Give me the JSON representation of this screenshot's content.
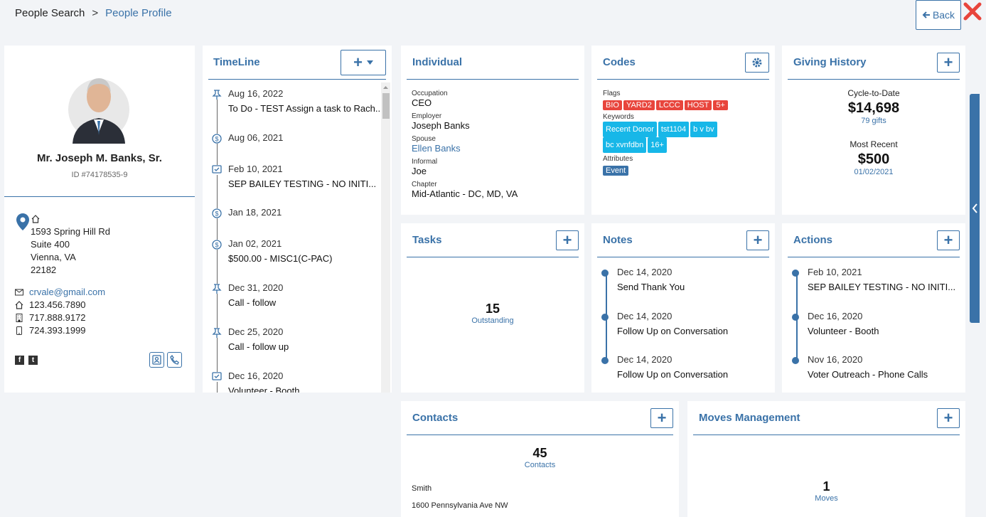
{
  "breadcrumb": {
    "root": "People Search",
    "sep": ">",
    "current": "People Profile"
  },
  "header": {
    "back_label": "Back"
  },
  "profile": {
    "name": "Mr. Joseph M. Banks, Sr.",
    "id": "ID #74178535-9",
    "address": [
      "1593 Spring Hill Rd",
      "Suite 400",
      "Vienna, VA",
      "22182"
    ],
    "email": "crvale@gmail.com",
    "phone_home": "123.456.7890",
    "phone_work": "717.888.9172",
    "phone_mobile": "724.393.1999"
  },
  "timeline": {
    "title": "TimeLine",
    "items": [
      {
        "date": "Aug 16, 2022",
        "text": "To Do - TEST Assign a task to Rach...",
        "icon": "pin-icon"
      },
      {
        "date": "Aug 06, 2021",
        "text": "",
        "icon": "dollar-icon"
      },
      {
        "date": "Feb 10, 2021",
        "text": "SEP BAILEY TESTING - NO INITI...",
        "icon": "check-icon"
      },
      {
        "date": "Jan 18, 2021",
        "text": "",
        "icon": "dollar-icon"
      },
      {
        "date": "Jan 02, 2021",
        "text": "$500.00 - MISC1(C-PAC)",
        "icon": "dollar-icon"
      },
      {
        "date": "Dec 31, 2020",
        "text": "Call - follow",
        "icon": "pin-icon"
      },
      {
        "date": "Dec 25, 2020",
        "text": "Call - follow up",
        "icon": "pin-icon"
      },
      {
        "date": "Dec 16, 2020",
        "text": "Volunteer - Booth",
        "icon": "check-icon"
      }
    ]
  },
  "individual": {
    "title": "Individual",
    "fields": [
      {
        "label": "Occupation",
        "value": "CEO",
        "link": false
      },
      {
        "label": "Employer",
        "value": "Joseph Banks",
        "link": false
      },
      {
        "label": "Spouse",
        "value": "Ellen Banks",
        "link": true
      },
      {
        "label": "Informal",
        "value": "Joe",
        "link": false
      },
      {
        "label": "Chapter",
        "value": "Mid-Atlantic - DC, MD, VA",
        "link": false
      }
    ]
  },
  "codes": {
    "title": "Codes",
    "flags_label": "Flags",
    "flags": [
      "BIO",
      "YARD2",
      "LCCC",
      "HOST",
      "5+"
    ],
    "keywords_label": "Keywords",
    "keywords": [
      "Recent Donor",
      "tst1104",
      "b v bv",
      "bc xvnfdbn",
      "16+"
    ],
    "attributes_label": "Attributes",
    "attributes": [
      "Event"
    ]
  },
  "giving": {
    "title": "Giving History",
    "ctd_label": "Cycle-to-Date",
    "ctd_amount": "$14,698",
    "ctd_gifts": "79 gifts",
    "recent_label": "Most Recent",
    "recent_amount": "$500",
    "recent_date": "01/02/2021"
  },
  "tasks": {
    "title": "Tasks",
    "count": "15",
    "label": "Outstanding"
  },
  "notes": {
    "title": "Notes",
    "items": [
      {
        "date": "Dec 14, 2020",
        "text": "Send Thank You"
      },
      {
        "date": "Dec 14, 2020",
        "text": "Follow Up on Conversation"
      },
      {
        "date": "Dec 14, 2020",
        "text": "Follow Up on Conversation"
      }
    ]
  },
  "actions": {
    "title": "Actions",
    "items": [
      {
        "date": "Feb 10, 2021",
        "text": "SEP BAILEY TESTING - NO INITI..."
      },
      {
        "date": "Dec 16, 2020",
        "text": "Volunteer - Booth"
      },
      {
        "date": "Nov 16, 2020",
        "text": "Voter Outreach - Phone Calls"
      }
    ]
  },
  "contacts": {
    "title": "Contacts",
    "count": "45",
    "label": "Contacts",
    "name": "Smith",
    "address": "1600 Pennsylvania Ave NW"
  },
  "moves": {
    "title": "Moves Management",
    "count": "1",
    "label": "Moves"
  },
  "colors": {
    "accent": "#3a72a8",
    "flag_red": "#e8453c",
    "keyword_cyan": "#17b7e8"
  }
}
